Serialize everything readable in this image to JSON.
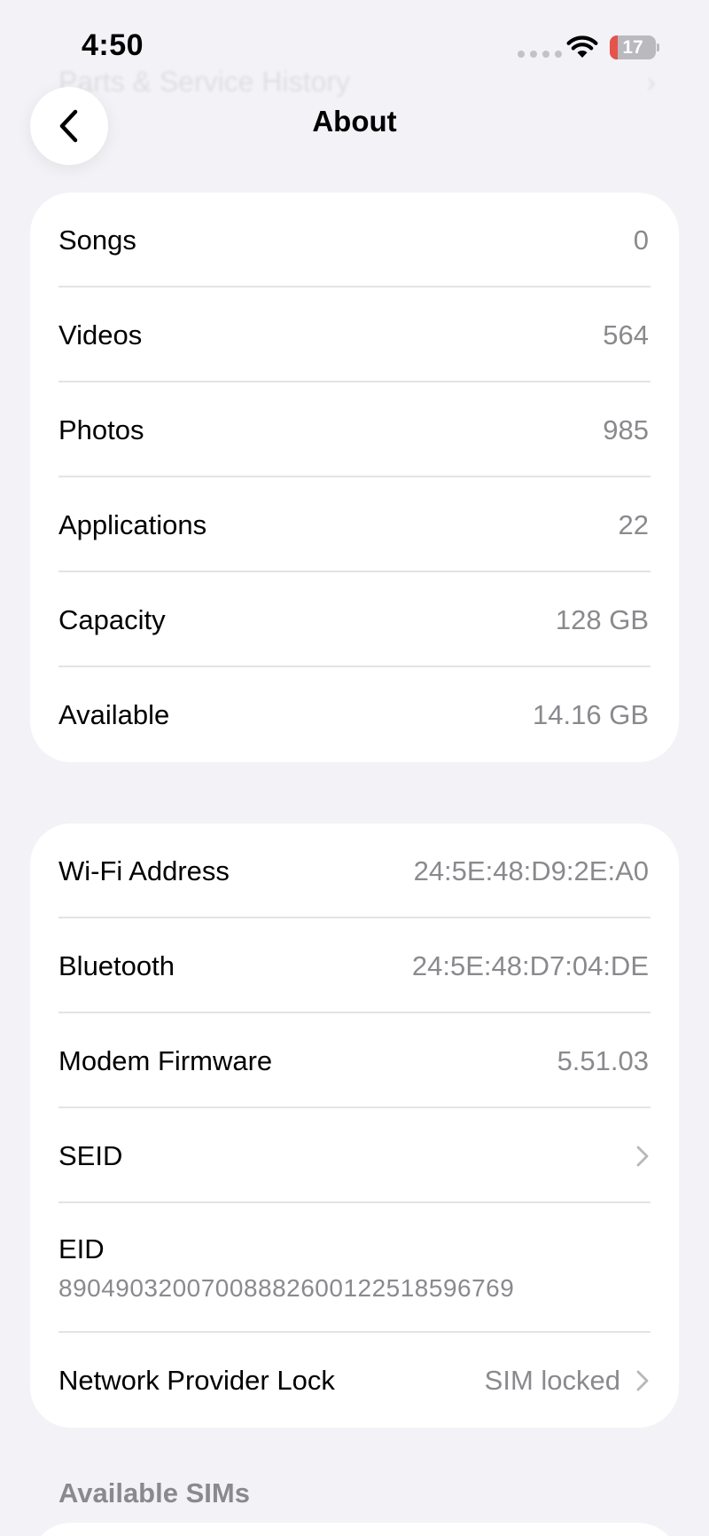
{
  "background_hint": {
    "label": "Parts & Service History"
  },
  "status_bar": {
    "time": "4:50",
    "battery_level": "17",
    "battery_fraction": 0.17
  },
  "nav": {
    "title": "About"
  },
  "storage_group": [
    {
      "label": "Songs",
      "value": "0"
    },
    {
      "label": "Videos",
      "value": "564"
    },
    {
      "label": "Photos",
      "value": "985"
    },
    {
      "label": "Applications",
      "value": "22"
    },
    {
      "label": "Capacity",
      "value": "128 GB"
    },
    {
      "label": "Available",
      "value": "14.16 GB"
    }
  ],
  "network_group": {
    "wifi": {
      "label": "Wi-Fi Address",
      "value": "24:5E:48:D9:2E:A0"
    },
    "bluetooth": {
      "label": "Bluetooth",
      "value": "24:5E:48:D7:04:DE"
    },
    "modem": {
      "label": "Modem Firmware",
      "value": "5.51.03"
    },
    "seid": {
      "label": "SEID"
    },
    "eid": {
      "label": "EID",
      "value": "89049032007008882600122518596769"
    },
    "lock": {
      "label": "Network Provider Lock",
      "value": "SIM locked"
    }
  },
  "sims_section": {
    "header": "Available SIMs"
  },
  "colors": {
    "background": "#f2f2f7",
    "card": "#ffffff",
    "secondary_text": "#8a8a8e",
    "battery_low": "#e5534b"
  }
}
